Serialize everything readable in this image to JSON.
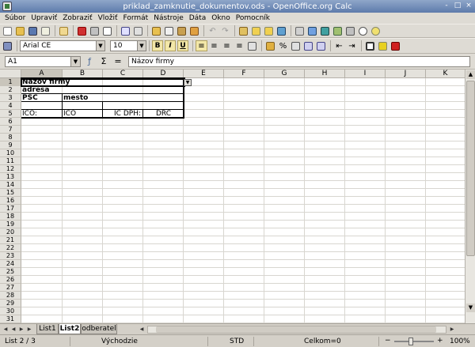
{
  "window": {
    "title": "priklad_zamknutie_dokumentov.ods - OpenOffice.org Calc",
    "buttons": [
      "-",
      "□",
      "×"
    ]
  },
  "menu": [
    "Súbor",
    "Upraviť",
    "Zobraziť",
    "Vložiť",
    "Formát",
    "Nástroje",
    "Dáta",
    "Okno",
    "Pomocník"
  ],
  "toolbar1": {
    "icons": [
      "new-document-icon",
      "open-icon",
      "save-icon",
      "email-icon",
      "edit-file-icon",
      "export-pdf-icon",
      "print-icon",
      "page-preview-icon",
      "spellcheck-icon",
      "autospellcheck-icon",
      "cut-icon",
      "copy-icon",
      "paste-icon",
      "clone-formatting-icon",
      "undo-icon",
      "redo-icon",
      "hyperlink-icon",
      "sort-ascending-icon",
      "sort-descending-icon",
      "insert-chart-icon",
      "show-draw-functions-icon",
      "find-replace-icon",
      "navigator-icon",
      "gallery-icon",
      "data-sources-icon",
      "zoom-icon",
      "help-icon"
    ]
  },
  "toolbar2": {
    "font_name": "Arial CE",
    "font_size": "10",
    "bold": "B",
    "italic": "I",
    "underline": "U",
    "icons": [
      "styles-icon",
      "align-left-icon",
      "align-center-icon",
      "align-right-icon",
      "justify-icon",
      "merge-cells-icon",
      "currency-icon",
      "percent-icon",
      "standard-format-icon",
      "add-decimal-icon",
      "delete-decimal-icon",
      "decrease-indent-icon",
      "increase-indent-icon",
      "borders-icon",
      "background-color-icon",
      "font-color-icon"
    ]
  },
  "formula_bar": {
    "cell_ref": "A1",
    "content": "Názov firmy"
  },
  "columns": [
    "A",
    "B",
    "C",
    "D",
    "E",
    "F",
    "G",
    "H",
    "I",
    "J",
    "K"
  ],
  "rows": [
    "1",
    "2",
    "3",
    "4",
    "5",
    "6",
    "7",
    "8",
    "9",
    "10",
    "11",
    "12",
    "13",
    "14",
    "15",
    "16",
    "17",
    "18",
    "19",
    "20",
    "21",
    "22",
    "23",
    "24",
    "25",
    "26",
    "27",
    "28",
    "29",
    "30",
    "31"
  ],
  "cells": {
    "a1": "Názov firmy",
    "a2": "adresa",
    "a3": "PSČ",
    "b3": "mesto",
    "a5": "IČO:",
    "b5": "IČO",
    "c5": "IČ DPH:",
    "d5": "DRČ"
  },
  "sheet_tabs": [
    "List1",
    "List2",
    "odberatel"
  ],
  "status": {
    "sheet": "List 2 / 3",
    "style": "Východzie",
    "mode": "STD",
    "sum": "Celkom=0",
    "zoom": "100%"
  }
}
